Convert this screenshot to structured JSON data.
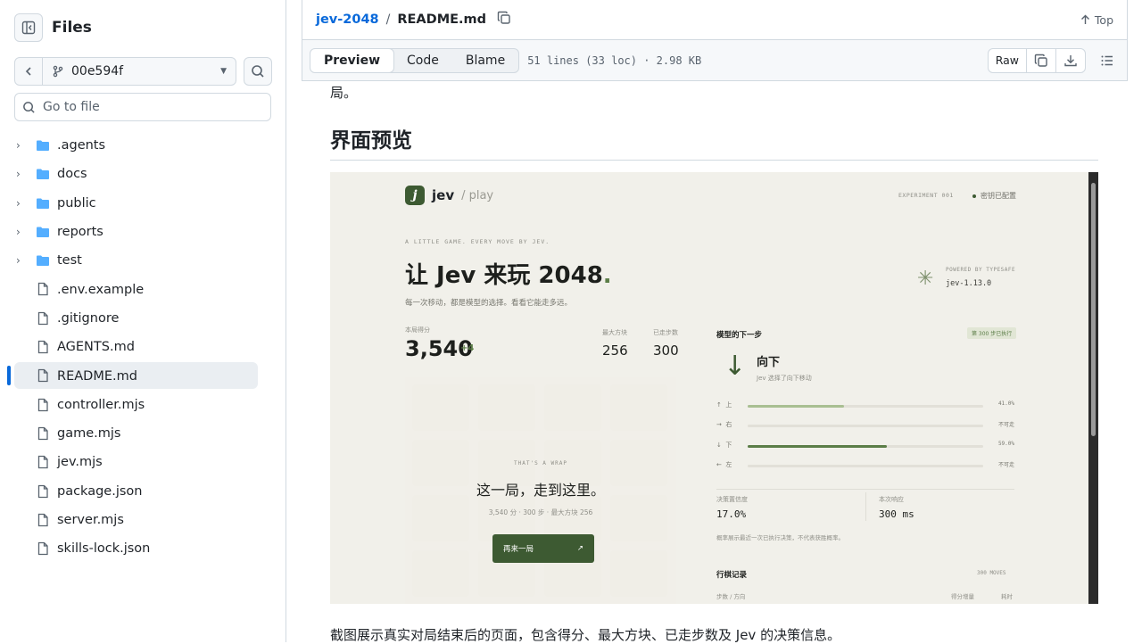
{
  "sidebar": {
    "title": "Files",
    "branch": "00e594f",
    "goto_placeholder": "Go to file",
    "items": [
      {
        "label": ".agents",
        "type": "folder"
      },
      {
        "label": "docs",
        "type": "folder"
      },
      {
        "label": "public",
        "type": "folder"
      },
      {
        "label": "reports",
        "type": "folder"
      },
      {
        "label": "test",
        "type": "folder"
      },
      {
        "label": ".env.example",
        "type": "file"
      },
      {
        "label": ".gitignore",
        "type": "file"
      },
      {
        "label": "AGENTS.md",
        "type": "file"
      },
      {
        "label": "README.md",
        "type": "file",
        "active": true
      },
      {
        "label": "controller.mjs",
        "type": "file"
      },
      {
        "label": "game.mjs",
        "type": "file"
      },
      {
        "label": "jev.mjs",
        "type": "file"
      },
      {
        "label": "package.json",
        "type": "file"
      },
      {
        "label": "server.mjs",
        "type": "file"
      },
      {
        "label": "skills-lock.json",
        "type": "file"
      }
    ]
  },
  "header": {
    "repo": "jev-2048",
    "separator": "/",
    "file": "README.md",
    "top_label": "Top"
  },
  "toolbar": {
    "tabs": [
      "Preview",
      "Code",
      "Blame"
    ],
    "active_tab": "Preview",
    "meta": "51 lines (33 loc) · 2.98 KB",
    "raw_label": "Raw"
  },
  "content": {
    "line_top": "局。",
    "heading": "界面预览",
    "paragraph": "截图展示真实对局结束后的页面，包含得分、最大方块、已走步数及 Jev 的决策信息。"
  },
  "screenshot": {
    "brand": "jev",
    "brand_sub": "/ play",
    "experiment": "EXPERIMENT 001",
    "key_status": "密钥已配置",
    "kicker": "A LITTLE GAME. EVERY MOVE BY JEV.",
    "title_prefix": "让 Jev 来玩 ",
    "title_num": "2048",
    "title_dot": ".",
    "subtitle": "每一次移动，都是模型的选择。看看它能走多远。",
    "powered": "POWERED BY TYPESAFE",
    "version": "jev-1.13.0",
    "score_label": "本局得分",
    "score": "3,540",
    "score_delta": "+4",
    "max_tile_label": "最大方块",
    "max_tile": "256",
    "steps_label": "已走步数",
    "steps": "300",
    "wrap_kicker": "THAT'S A WRAP",
    "wrap_title": "这一局，走到这里。",
    "wrap_sub": "3,540 分 · 300 步 · 最大方块 256",
    "again_label": "再来一局",
    "again_arrow": "↗",
    "panel_title": "模型的下一步",
    "panel_badge": "第 300 步已执行",
    "direction_arrow": "↓",
    "direction": "向下",
    "direction_sub": "Jev 选择了向下移动",
    "probs": [
      {
        "arrow": "↑",
        "label": "上",
        "value": 0.41,
        "text": "41.0%"
      },
      {
        "arrow": "→",
        "label": "右",
        "value": 0,
        "text": "不可走"
      },
      {
        "arrow": "↓",
        "label": "下",
        "value": 0.59,
        "text": "59.0%",
        "strong": true
      },
      {
        "arrow": "←",
        "label": "左",
        "value": 0,
        "text": "不可走"
      }
    ],
    "confidence_label": "决策置信度",
    "confidence": "17.0%",
    "latency_label": "本次响应",
    "latency": "300 ms",
    "note": "概率展示最近一次已执行决策，不代表获胜概率。",
    "log_title": "行棋记录",
    "log_moves": "300 MOVES",
    "log_col1": "步数 / 方向",
    "log_col2": "得分增量",
    "log_col3": "耗时"
  }
}
